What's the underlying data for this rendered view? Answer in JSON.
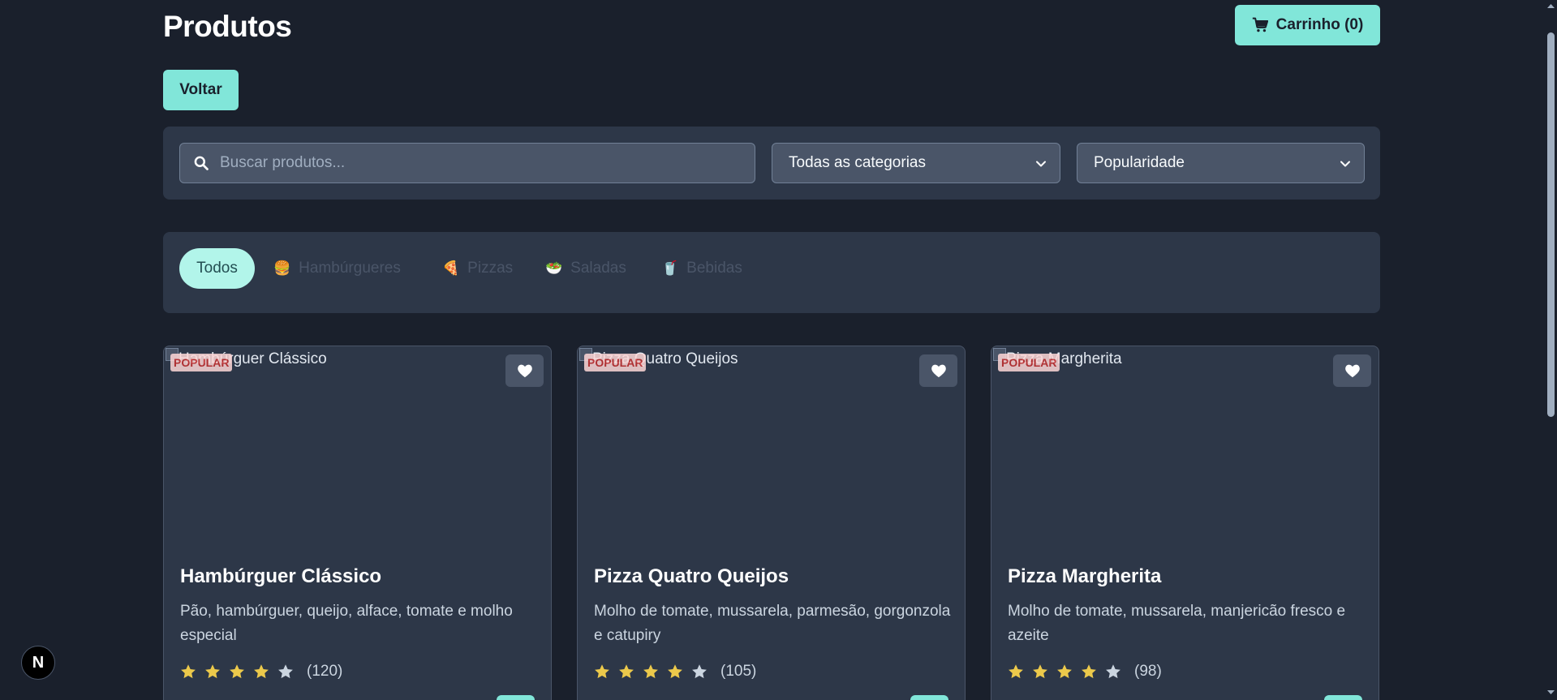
{
  "header": {
    "title": "Produtos",
    "cart_label": "Carrinho (0)",
    "back_label": "Voltar"
  },
  "filters": {
    "search_placeholder": "Buscar produtos...",
    "category_selected": "Todas as categorias",
    "sort_selected": "Popularidade"
  },
  "tabs": [
    {
      "label": "Todos",
      "emoji": "",
      "active": true
    },
    {
      "label": "Hambúrgueres",
      "emoji": "🍔",
      "active": false
    },
    {
      "label": "Pizzas",
      "emoji": "🍕",
      "active": false
    },
    {
      "label": "Saladas",
      "emoji": "🥗",
      "active": false
    },
    {
      "label": "Bebidas",
      "emoji": "🥤",
      "active": false
    }
  ],
  "products": [
    {
      "image_alt": "Hambúrguer Clássico",
      "badge": "POPULAR",
      "name": "Hambúrguer Clássico",
      "description": "Pão, hambúrguer, queijo, alface, tomate e molho especial",
      "rating": 4,
      "reviews": "(120)"
    },
    {
      "image_alt": "Pizza Quatro Queijos",
      "badge": "POPULAR",
      "name": "Pizza Quatro Queijos",
      "description": "Molho de tomate, mussarela, parmesão, gorgonzola e catupiry",
      "rating": 4,
      "reviews": "(105)"
    },
    {
      "image_alt": "Pizza Margherita",
      "badge": "POPULAR",
      "name": "Pizza Margherita",
      "description": "Molho de tomate, mussarela, manjericão fresco e azeite",
      "rating": 4,
      "reviews": "(98)"
    }
  ],
  "dev_badge": "N",
  "colors": {
    "background": "#1a202c",
    "panel": "#2d3748",
    "accent": "#81e6d9",
    "star_filled": "#ecc94b",
    "star_empty": "#cbd5e0"
  },
  "icons": {
    "cart": "cart-icon",
    "search": "search-icon",
    "chevron": "chevron-down-icon",
    "favorite": "heart-icon",
    "star": "star-icon"
  }
}
